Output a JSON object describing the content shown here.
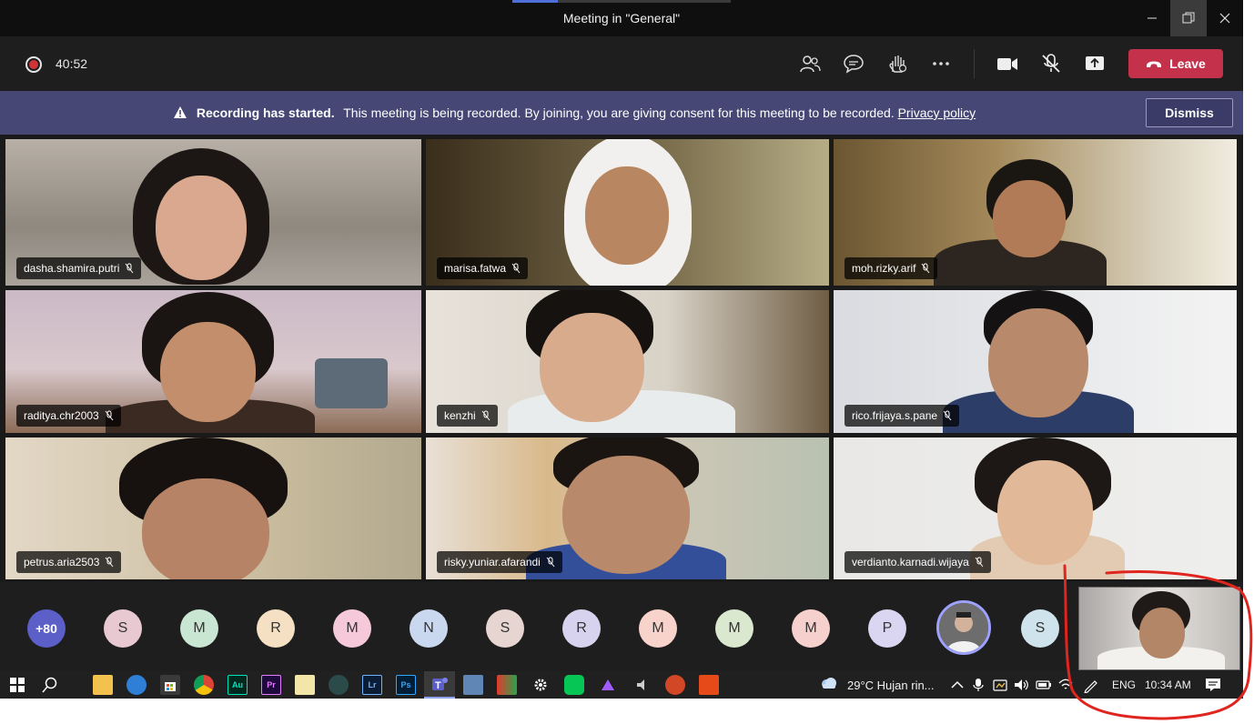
{
  "window": {
    "title": "Meeting in \"General\""
  },
  "toolbar": {
    "timer": "40:52",
    "leave_label": "Leave"
  },
  "banner": {
    "strong": "Recording has started.",
    "message": "This meeting is being recorded. By joining, you are giving consent for this meeting to be recorded.",
    "link": "Privacy policy",
    "dismiss_label": "Dismiss"
  },
  "participants": [
    {
      "name": "dasha.shamira.putri"
    },
    {
      "name": "marisa.fatwa"
    },
    {
      "name": "moh.rizky.arif"
    },
    {
      "name": "raditya.chr2003"
    },
    {
      "name": "kenzhi"
    },
    {
      "name": "rico.frijaya.s.pane"
    },
    {
      "name": "petrus.aria2503"
    },
    {
      "name": "risky.yuniar.afarandi"
    },
    {
      "name": "verdianto.karnadi.wijaya"
    }
  ],
  "strip": {
    "more": "+80",
    "avatars": [
      {
        "initial": "S",
        "color": "#e8c9d1"
      },
      {
        "initial": "M",
        "color": "#c9e6d3"
      },
      {
        "initial": "R",
        "color": "#f6e0c4"
      },
      {
        "initial": "M",
        "color": "#f5c9d9"
      },
      {
        "initial": "N",
        "color": "#c9d8ee"
      },
      {
        "initial": "S",
        "color": "#e6d5d1"
      },
      {
        "initial": "R",
        "color": "#d7d3ee"
      },
      {
        "initial": "M",
        "color": "#f7d3cb"
      },
      {
        "initial": "M",
        "color": "#d9e8cf"
      },
      {
        "initial": "M",
        "color": "#f5d0cd"
      },
      {
        "initial": "P",
        "color": "#dad5f0"
      },
      {
        "initial": "S",
        "color": "#cfe3ec"
      }
    ]
  },
  "taskbar": {
    "weather": "29°C  Hujan rin...",
    "lang": "ENG",
    "time": "10:34 AM",
    "apps": [
      "Au",
      "Pr",
      "Lr",
      "Ps"
    ]
  },
  "colors": {
    "accent": "#5b5fc7",
    "leave": "#c4314b",
    "banner": "#464775",
    "annotation": "#e0241e"
  }
}
